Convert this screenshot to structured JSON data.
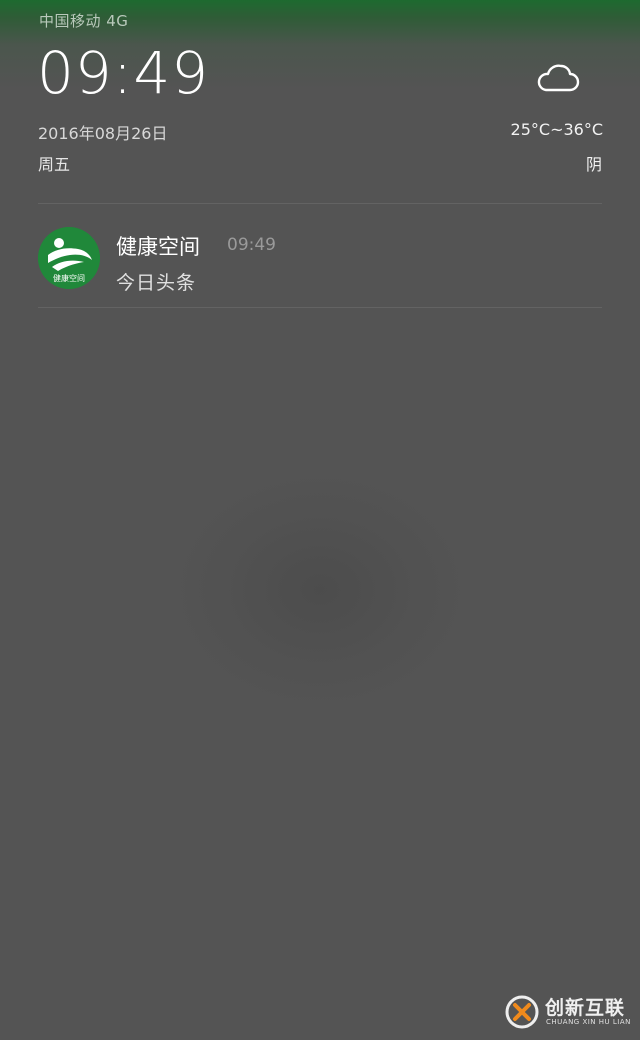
{
  "status_bar": {
    "carrier": "中国移动 4G"
  },
  "lock_screen": {
    "time": "09:49",
    "date": "2016年08月26日",
    "weekday": "周五"
  },
  "weather": {
    "icon": "cloud-icon",
    "temperature": "25°C~36°C",
    "condition": "阴"
  },
  "notifications": [
    {
      "app_name": "健康空间",
      "time": "09:49",
      "message": "今日头条",
      "icon": "health-space-app-icon",
      "icon_text": "健康空间",
      "icon_color": "#20883a"
    }
  ],
  "watermark": {
    "text": "创新互联",
    "subtext": "CHUANG XIN HU LIAN"
  }
}
